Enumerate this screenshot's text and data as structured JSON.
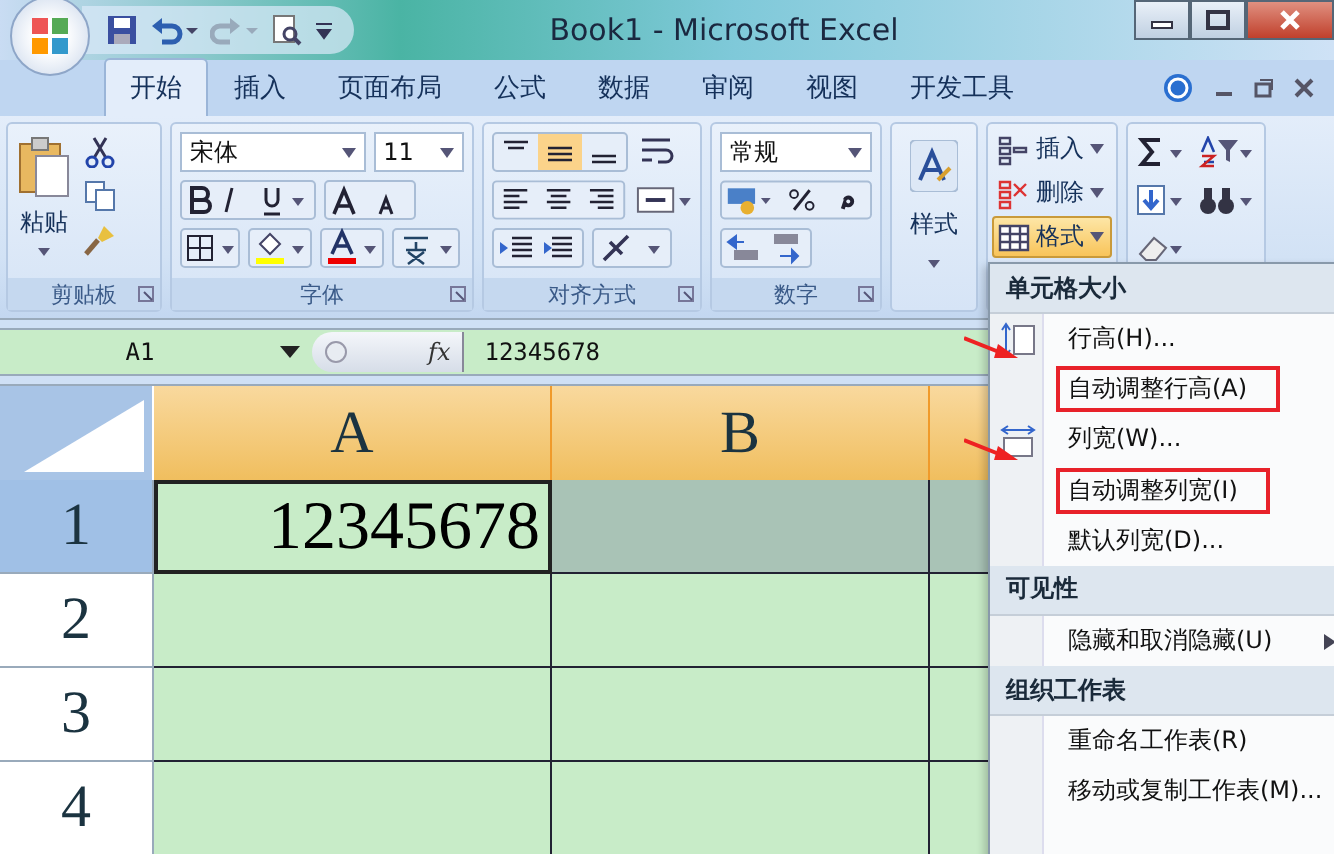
{
  "window": {
    "title": "Book1 - Microsoft Excel"
  },
  "tabs": [
    {
      "label": "开始",
      "selected": true
    },
    {
      "label": "插入",
      "selected": false
    },
    {
      "label": "页面布局",
      "selected": false
    },
    {
      "label": "公式",
      "selected": false
    },
    {
      "label": "数据",
      "selected": false
    },
    {
      "label": "审阅",
      "selected": false
    },
    {
      "label": "视图",
      "selected": false
    },
    {
      "label": "开发工具",
      "selected": false
    }
  ],
  "ribbon": {
    "clipboard": {
      "paste": "粘贴",
      "label": "剪贴板"
    },
    "font": {
      "name": "宋体",
      "size": "11",
      "label": "字体"
    },
    "alignment": {
      "label": "对齐方式"
    },
    "number": {
      "format": "常规",
      "label": "数字"
    },
    "styles": {
      "label": "样式"
    },
    "cells": [
      {
        "label": "插入",
        "kind": "insert",
        "selected": false
      },
      {
        "label": "删除",
        "kind": "delete",
        "selected": false
      },
      {
        "label": "格式",
        "kind": "format",
        "selected": true
      }
    ]
  },
  "formula_bar": {
    "name_box": "A1",
    "function_button": "fx",
    "value": "12345678"
  },
  "sheet": {
    "columns": [
      {
        "label": "A"
      },
      {
        "label": "B"
      }
    ],
    "rows": [
      {
        "label": "1",
        "selected": true,
        "cells": [
          {
            "value": "12345678",
            "selected": true,
            "shaded": false
          },
          {
            "selected": false,
            "shaded": true
          },
          {
            "selected": false,
            "shaded": true
          }
        ]
      },
      {
        "label": "2",
        "selected": false,
        "cells": [
          {
            "selected": false,
            "shaded": false
          },
          {
            "selected": false,
            "shaded": false
          },
          {
            "selected": false,
            "shaded": false
          }
        ]
      },
      {
        "label": "3",
        "selected": false,
        "cells": [
          {
            "selected": false,
            "shaded": false
          },
          {
            "selected": false,
            "shaded": false
          },
          {
            "selected": false,
            "shaded": false
          }
        ]
      },
      {
        "label": "4",
        "selected": false,
        "cells": [
          {
            "selected": false,
            "shaded": false
          },
          {
            "selected": false,
            "shaded": false
          },
          {
            "selected": false,
            "shaded": false
          }
        ]
      }
    ]
  },
  "format_menu": {
    "sections": [
      {
        "title": "单元格大小",
        "items": [
          {
            "label": "行高(H)...",
            "kind": "row-height",
            "highlighted": false,
            "submenu": false
          },
          {
            "label": "自动调整行高(A)",
            "kind": "plain",
            "highlighted": true,
            "submenu": false
          },
          {
            "label": "列宽(W)...",
            "kind": "column-width",
            "highlighted": false,
            "submenu": false
          },
          {
            "label": "自动调整列宽(I)",
            "kind": "plain",
            "highlighted": true,
            "submenu": false
          },
          {
            "label": "默认列宽(D)...",
            "kind": "plain",
            "highlighted": false,
            "submenu": false
          }
        ]
      },
      {
        "title": "可见性",
        "items": [
          {
            "label": "隐藏和取消隐藏(U)",
            "kind": "plain",
            "highlighted": false,
            "submenu": true
          }
        ]
      },
      {
        "title": "组织工作表",
        "items": [
          {
            "label": "重命名工作表(R)",
            "kind": "plain",
            "highlighted": false,
            "submenu": false
          },
          {
            "label": "移动或复制工作表(M)...",
            "kind": "plain",
            "highlighted": false,
            "submenu": false
          }
        ]
      }
    ]
  }
}
